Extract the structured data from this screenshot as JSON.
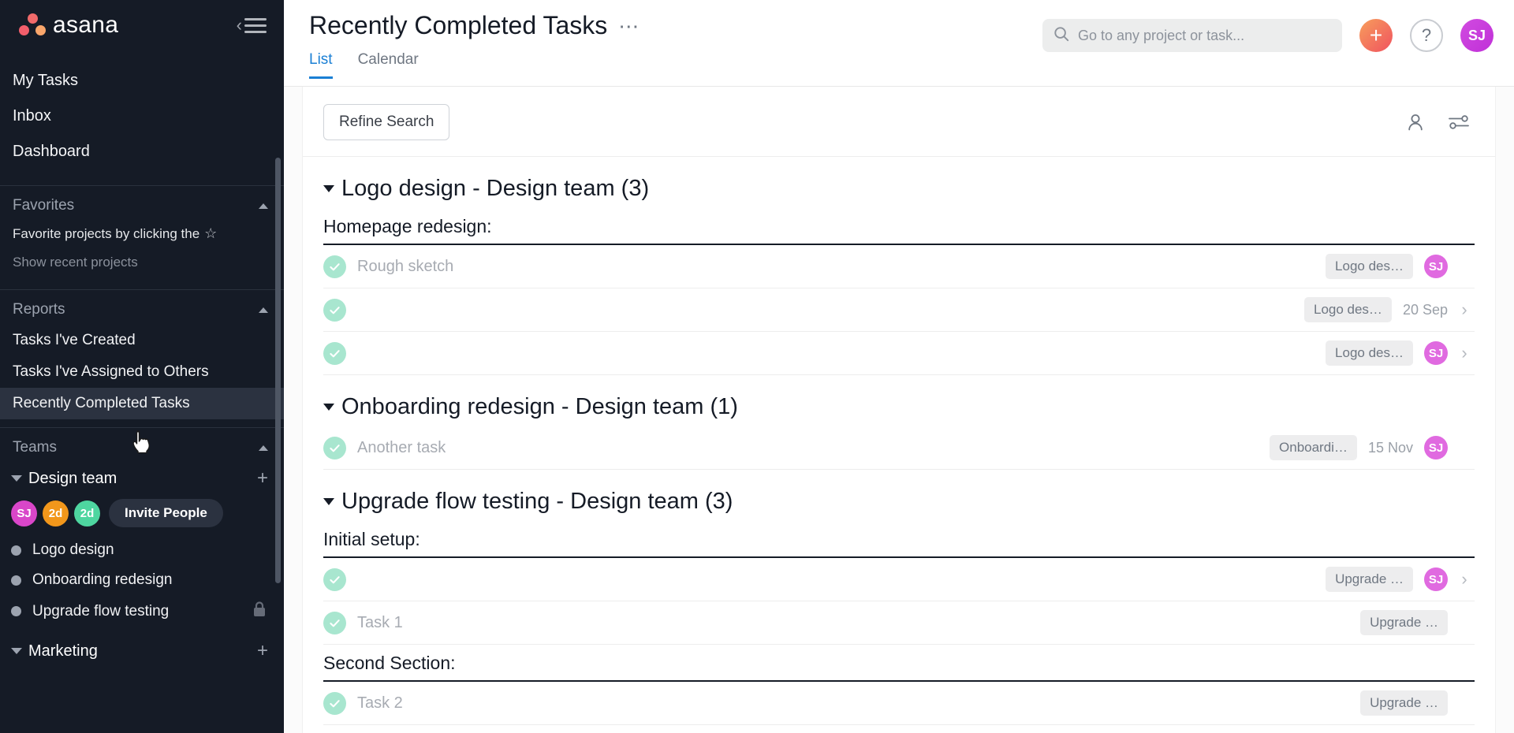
{
  "sidebar": {
    "brand": "asana",
    "collapse_label": "Collapse sidebar",
    "nav": [
      {
        "label": "My Tasks"
      },
      {
        "label": "Inbox"
      },
      {
        "label": "Dashboard"
      }
    ],
    "favorites": {
      "title": "Favorites",
      "hint": "Favorite projects by clicking the",
      "star_glyph": "☆",
      "recent_projects": "Show recent projects"
    },
    "reports": {
      "title": "Reports",
      "items": [
        {
          "label": "Tasks I've Created",
          "active": false
        },
        {
          "label": "Tasks I've Assigned to Others",
          "active": false
        },
        {
          "label": "Recently Completed Tasks",
          "active": true
        }
      ]
    },
    "teams": {
      "title": "Teams",
      "design_team": {
        "name": "Design team",
        "add_label": "+",
        "members": [
          {
            "initials": "SJ",
            "color": "#d946c9"
          },
          {
            "initials": "2d",
            "color": "#f2971b"
          },
          {
            "initials": "2d",
            "color": "#4ed6a0"
          }
        ],
        "invite_label": "Invite People",
        "projects": [
          {
            "name": "Logo design",
            "locked": false
          },
          {
            "name": "Onboarding redesign",
            "locked": false
          },
          {
            "name": "Upgrade flow testing",
            "locked": true
          }
        ]
      },
      "marketing": {
        "name": "Marketing",
        "add_label": "+"
      }
    }
  },
  "header": {
    "title": "Recently Completed Tasks",
    "more_glyph": "⋯",
    "tabs": [
      {
        "label": "List",
        "active": true
      },
      {
        "label": "Calendar",
        "active": false
      }
    ],
    "search": {
      "placeholder": "Go to any project or task...",
      "value": ""
    },
    "add_label": "+",
    "help_label": "?",
    "avatar": {
      "initials": "SJ",
      "color": "#c030d8"
    }
  },
  "toolbar": {
    "refine_label": "Refine Search",
    "assignee_icon": "person-icon",
    "filter_icon": "filter-sliders-icon"
  },
  "groups": [
    {
      "title": "Logo design - Design team (3)",
      "expanded": true,
      "sections": [
        {
          "title": "Homepage redesign:",
          "tasks": [
            {
              "name": "Rough sketch",
              "pill": "Logo des…",
              "due": "",
              "avatar": "SJ",
              "avatar_color": "#e06ae0",
              "chevron": false
            },
            {
              "name": "",
              "pill": "Logo des…",
              "due": "20 Sep",
              "avatar": "",
              "avatar_color": "",
              "chevron": true
            },
            {
              "name": "",
              "pill": "Logo des…",
              "due": "",
              "avatar": "SJ",
              "avatar_color": "#e06ae0",
              "chevron": true
            }
          ]
        }
      ]
    },
    {
      "title": "Onboarding redesign - Design team (1)",
      "expanded": true,
      "sections": [
        {
          "title": "",
          "tasks": [
            {
              "name": "Another task",
              "pill": "Onboardi…",
              "due": "15 Nov",
              "avatar": "SJ",
              "avatar_color": "#e06ae0",
              "chevron": false
            }
          ]
        }
      ]
    },
    {
      "title": "Upgrade flow testing - Design team (3)",
      "expanded": true,
      "sections": [
        {
          "title": "Initial setup:",
          "tasks": [
            {
              "name": "",
              "pill": "Upgrade …",
              "due": "",
              "avatar": "SJ",
              "avatar_color": "#e06ae0",
              "chevron": true
            },
            {
              "name": "Task 1",
              "pill": "Upgrade …",
              "due": "",
              "avatar": "",
              "avatar_color": "",
              "chevron": false
            }
          ]
        },
        {
          "title": "Second Section:",
          "tasks": [
            {
              "name": "Task 2",
              "pill": "Upgrade …",
              "due": "",
              "avatar": "",
              "avatar_color": "",
              "chevron": false
            }
          ]
        }
      ]
    }
  ]
}
